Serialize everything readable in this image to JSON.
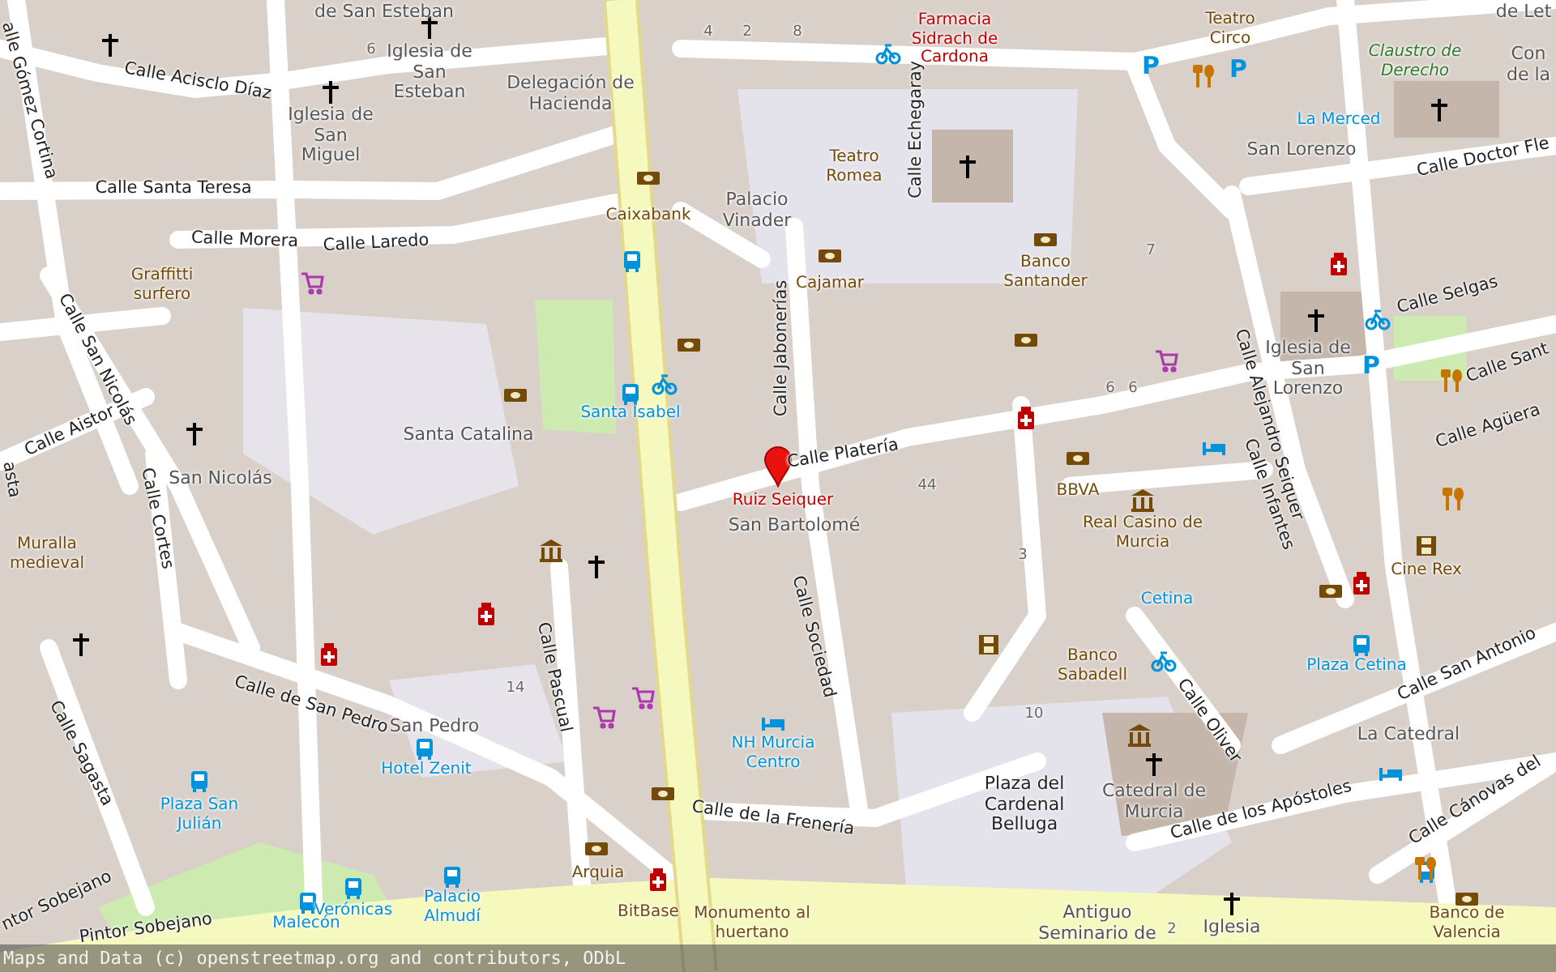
{
  "map": {
    "labels": [
      {
        "text": "de San Esteban",
        "kind": "place"
      },
      {
        "text": "Iglesia de San Esteban",
        "kind": "place"
      },
      {
        "text": "Iglesia de San Miguel",
        "kind": "place"
      },
      {
        "text": "Delegación de Hacienda",
        "kind": "place"
      },
      {
        "text": "Calle Acisclo Díaz",
        "kind": "street"
      },
      {
        "text": "alle Gómez Cortina",
        "kind": "street"
      },
      {
        "text": "Calle Santa Teresa",
        "kind": "street"
      },
      {
        "text": "Calle Morera",
        "kind": "street"
      },
      {
        "text": "Calle Laredo",
        "kind": "street"
      },
      {
        "text": "Graffitti surfero",
        "kind": "poi"
      },
      {
        "text": "Calle San Nicolás",
        "kind": "street"
      },
      {
        "text": "Calle Aistor",
        "kind": "street"
      },
      {
        "text": "Caixabank",
        "kind": "poi"
      },
      {
        "text": "Palacio Vinader",
        "kind": "place"
      },
      {
        "text": "Santa Catalina",
        "kind": "place"
      },
      {
        "text": "San Nicolás",
        "kind": "place"
      },
      {
        "text": "Santa Isabel",
        "kind": "transit"
      },
      {
        "text": "Farmacia Sidrach de Cardona",
        "kind": "pharmacy"
      },
      {
        "text": "Teatro Romea",
        "kind": "poi"
      },
      {
        "text": "Calle Echegaray",
        "kind": "street"
      },
      {
        "text": "Teatro Circo",
        "kind": "poi"
      },
      {
        "text": "de Let",
        "kind": "place"
      },
      {
        "text": "Claustro de Derecho",
        "kind": "park"
      },
      {
        "text": "Con de la",
        "kind": "place"
      },
      {
        "text": "La Merced",
        "kind": "transit"
      },
      {
        "text": "San Lorenzo",
        "kind": "place"
      },
      {
        "text": "Calle Doctor Fle",
        "kind": "street"
      },
      {
        "text": "Cajamar",
        "kind": "poi"
      },
      {
        "text": "Banco Santander",
        "kind": "poi"
      },
      {
        "text": "Calle Jabonerías",
        "kind": "street"
      },
      {
        "text": "Calle Alejandro Seiquer",
        "kind": "street"
      },
      {
        "text": "Calle Selgas",
        "kind": "street"
      },
      {
        "text": "Iglesia de San Lorenzo",
        "kind": "place"
      },
      {
        "text": "Calle Sant",
        "kind": "street"
      },
      {
        "text": "Calle Agüera",
        "kind": "street"
      },
      {
        "text": "Calle Platería",
        "kind": "street"
      },
      {
        "text": "Ruiz Seiquer",
        "kind": "pharmacy"
      },
      {
        "text": "San Bartolomé",
        "kind": "place"
      },
      {
        "text": "BBVA",
        "kind": "poi"
      },
      {
        "text": "Real Casino de Murcia",
        "kind": "poi"
      },
      {
        "text": "Calle Infantes",
        "kind": "street"
      },
      {
        "text": "Cine Rex",
        "kind": "poi"
      },
      {
        "text": "Muralla medieval",
        "kind": "poi"
      },
      {
        "text": "Calle Cortes",
        "kind": "street"
      },
      {
        "text": "asta",
        "kind": "street"
      },
      {
        "text": "Calle Sociedad",
        "kind": "street"
      },
      {
        "text": "Cetina",
        "kind": "transit"
      },
      {
        "text": "Plaza Cetina",
        "kind": "transit"
      },
      {
        "text": "Calle de San Pedro",
        "kind": "street"
      },
      {
        "text": "Calle Pascual",
        "kind": "street"
      },
      {
        "text": "San Pedro",
        "kind": "place"
      },
      {
        "text": "Hotel Zenit",
        "kind": "transit"
      },
      {
        "text": "NH Murcia Centro",
        "kind": "transit"
      },
      {
        "text": "Banco Sabadell",
        "kind": "poi"
      },
      {
        "text": "Calle Oliver",
        "kind": "street"
      },
      {
        "text": "Calle San Antonio",
        "kind": "street"
      },
      {
        "text": "La Catedral",
        "kind": "place"
      },
      {
        "text": "Calle Sagasta",
        "kind": "street"
      },
      {
        "text": "Plaza San Julián",
        "kind": "transit"
      },
      {
        "text": "Calle de la Frenería",
        "kind": "street"
      },
      {
        "text": "Plaza del Cardenal Belluga",
        "kind": "square"
      },
      {
        "text": "Catedral de Murcia",
        "kind": "place"
      },
      {
        "text": "Calle de los Apóstoles",
        "kind": "street"
      },
      {
        "text": "Calle Cánovas del",
        "kind": "street"
      },
      {
        "text": "ntor Sobejano",
        "kind": "street"
      },
      {
        "text": "Arquia",
        "kind": "poi"
      },
      {
        "text": "Verónicas",
        "kind": "transit"
      },
      {
        "text": "Malecón",
        "kind": "transit"
      },
      {
        "text": "Palacio Almudí",
        "kind": "transit"
      },
      {
        "text": "BitBase",
        "kind": "poi"
      },
      {
        "text": "Monumento al huertano",
        "kind": "poi"
      },
      {
        "text": "Antiguo Seminario de",
        "kind": "place"
      },
      {
        "text": "Iglesia",
        "kind": "place"
      },
      {
        "text": "Banco de Valencia",
        "kind": "poi"
      },
      {
        "text": "Pintor Sobejano",
        "kind": "street"
      },
      {
        "text": "6",
        "kind": "number"
      },
      {
        "text": "4",
        "kind": "number"
      },
      {
        "text": "2",
        "kind": "number"
      },
      {
        "text": "8",
        "kind": "number"
      },
      {
        "text": "7",
        "kind": "number"
      },
      {
        "text": "6",
        "kind": "number"
      },
      {
        "text": "6",
        "kind": "number"
      },
      {
        "text": "44",
        "kind": "number"
      },
      {
        "text": "3",
        "kind": "number"
      },
      {
        "text": "10",
        "kind": "number"
      },
      {
        "text": "14",
        "kind": "number"
      },
      {
        "text": "2",
        "kind": "number"
      },
      {
        "text": "P",
        "kind": "parking"
      },
      {
        "text": "P",
        "kind": "parking"
      },
      {
        "text": "P",
        "kind": "parking"
      }
    ]
  },
  "attribution": "Maps and Data (c) openstreetmap.org and contributors, ODbL"
}
